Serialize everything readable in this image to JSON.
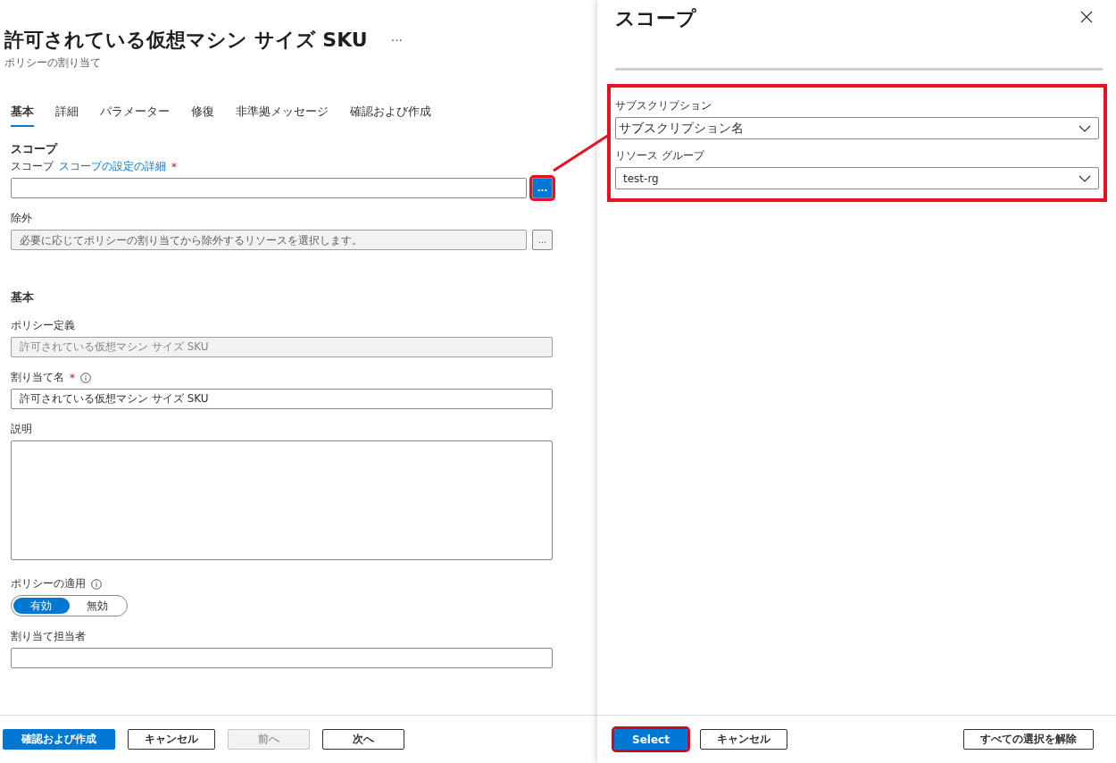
{
  "page": {
    "title": "許可されている仮想マシン サイズ SKU",
    "more": "···",
    "subtitle": "ポリシーの割り当て"
  },
  "tabs": [
    {
      "label": "基本",
      "selected": true
    },
    {
      "label": "詳細",
      "selected": false
    },
    {
      "label": "パラメーター",
      "selected": false
    },
    {
      "label": "修復",
      "selected": false
    },
    {
      "label": "非準拠メッセージ",
      "selected": false
    },
    {
      "label": "確認および作成",
      "selected": false
    }
  ],
  "scope": {
    "heading": "スコープ",
    "label": "スコープ",
    "link": "スコープの設定の詳細",
    "required_mark": "*",
    "browse": {
      "label": "...",
      "highlighted": true
    }
  },
  "exclusions": {
    "label": "除外",
    "placeholder": "必要に応じてポリシーの割り当てから除外するリソースを選択します。",
    "browse": {
      "label": "...",
      "highlighted": false
    }
  },
  "basics_heading": "基本",
  "fields": [
    {
      "kind": "readonly",
      "label": "ポリシー定義",
      "value": "許可されている仮想マシン サイズ SKU"
    },
    {
      "kind": "text",
      "label": "割り当て名",
      "value": "許可されている仮想マシン サイズ SKU",
      "required_mark": "*",
      "info": true
    },
    {
      "kind": "textarea",
      "label": "説明"
    },
    {
      "kind": "toggle",
      "label": "ポリシーの適用",
      "info": true,
      "options": [
        {
          "label": "有効",
          "selected": true
        },
        {
          "label": "無効",
          "selected": false
        }
      ]
    },
    {
      "kind": "text",
      "label": "割り当て担当者"
    }
  ],
  "footer_buttons": [
    {
      "label": "確認および作成",
      "kind": "primary",
      "disabled": false
    },
    {
      "label": "キャンセル",
      "kind": "default",
      "disabled": false
    },
    {
      "label": "前へ",
      "kind": "default",
      "disabled": true
    },
    {
      "label": "次へ",
      "kind": "default",
      "disabled": false
    }
  ],
  "panel": {
    "title": "スコープ",
    "highlighted": true,
    "dropdowns": [
      {
        "label": "サブスクリプション",
        "value": "サブスクリプション名"
      },
      {
        "label": "リソース グループ",
        "value": "test-rg"
      }
    ],
    "buttons": [
      {
        "label": "Select",
        "kind": "primary",
        "highlighted": true
      },
      {
        "label": "キャンセル",
        "kind": "default",
        "highlighted": false
      },
      {
        "label": "すべての選択を解除",
        "kind": "default",
        "highlighted": false
      }
    ]
  }
}
